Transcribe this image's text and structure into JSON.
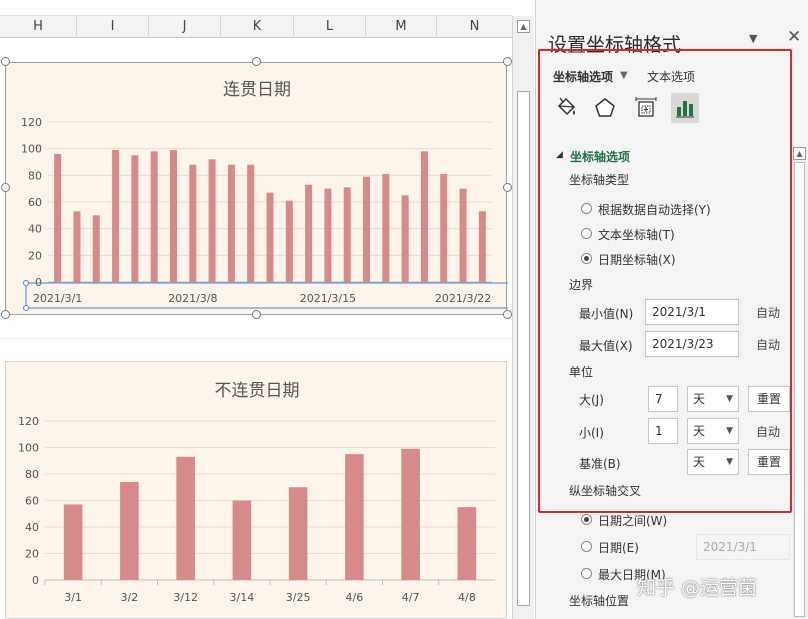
{
  "sheet": {
    "columns": [
      "H",
      "I",
      "J",
      "K",
      "L",
      "M",
      "N"
    ]
  },
  "pane": {
    "title": "设置坐标轴格式",
    "tabs": [
      {
        "label": "坐标轴选项",
        "active": true
      },
      {
        "label": "文本选项",
        "active": false
      }
    ],
    "icons": [
      "fill-bucket-icon",
      "pentagon-shape-icon",
      "size-properties-icon",
      "bar-chart-icon"
    ],
    "section": {
      "title": "坐标轴选项",
      "axis_type": {
        "label": "坐标轴类型",
        "options": [
          {
            "label": "根据数据自动选择(Y)",
            "selected": false
          },
          {
            "label": "文本坐标轴(T)",
            "selected": false
          },
          {
            "label": "日期坐标轴(X)",
            "selected": true
          }
        ]
      },
      "bounds": {
        "label": "边界",
        "min": {
          "label": "最小值(N)",
          "value": "2021/3/1",
          "auto": "自动"
        },
        "max": {
          "label": "最大值(X)",
          "value": "2021/3/23",
          "auto": "自动"
        }
      },
      "units": {
        "label": "单位",
        "major": {
          "label": "大(J)",
          "value": "7",
          "unit": "天",
          "action": "重置"
        },
        "minor": {
          "label": "小(I)",
          "value": "1",
          "unit": "天",
          "action": "自动"
        },
        "base": {
          "label": "基准(B)",
          "unit": "天",
          "action": "重置"
        }
      },
      "cross": {
        "label": "纵坐标轴交叉",
        "options": [
          {
            "label": "日期之间(W)",
            "selected": true
          },
          {
            "label": "日期(E)",
            "selected": false,
            "value": "2021/3/1"
          },
          {
            "label": "最大日期(M)",
            "selected": false
          }
        ]
      },
      "position_label": "坐标轴位置"
    }
  },
  "watermark": "知乎 @运营菌",
  "colors": {
    "bar": "#d68a8a",
    "chart_bg": "#fdf5ec",
    "highlight": "#e0262b",
    "section_green": "#217346"
  },
  "chart_data": [
    {
      "type": "bar",
      "title": "连贯日期",
      "x": [
        "2021/3/1",
        "2021/3/2",
        "2021/3/3",
        "2021/3/4",
        "2021/3/5",
        "2021/3/6",
        "2021/3/7",
        "2021/3/8",
        "2021/3/9",
        "2021/3/10",
        "2021/3/11",
        "2021/3/12",
        "2021/3/13",
        "2021/3/14",
        "2021/3/15",
        "2021/3/16",
        "2021/3/17",
        "2021/3/18",
        "2021/3/19",
        "2021/3/20",
        "2021/3/21",
        "2021/3/22"
      ],
      "values": [
        96,
        53,
        50,
        99,
        95,
        98,
        99,
        88,
        92,
        88,
        88,
        67,
        61,
        73,
        70,
        71,
        79,
        81,
        65,
        98,
        81,
        70,
        53
      ],
      "x_ticks": [
        "2021/3/1",
        "2021/3/8",
        "2021/3/15",
        "2021/3/22"
      ],
      "ylim": [
        0,
        120
      ],
      "y_ticks": [
        0,
        20,
        40,
        60,
        80,
        100,
        120
      ],
      "grid": true,
      "xlabel": "",
      "ylabel": ""
    },
    {
      "type": "bar",
      "title": "不连贯日期",
      "categories": [
        "3/1",
        "3/2",
        "3/12",
        "3/14",
        "3/25",
        "4/6",
        "4/7",
        "4/8"
      ],
      "values": [
        57,
        74,
        93,
        60,
        70,
        95,
        99,
        55
      ],
      "ylim": [
        0,
        120
      ],
      "y_ticks": [
        0,
        20,
        40,
        60,
        80,
        100,
        120
      ],
      "grid": true,
      "xlabel": "",
      "ylabel": ""
    }
  ]
}
